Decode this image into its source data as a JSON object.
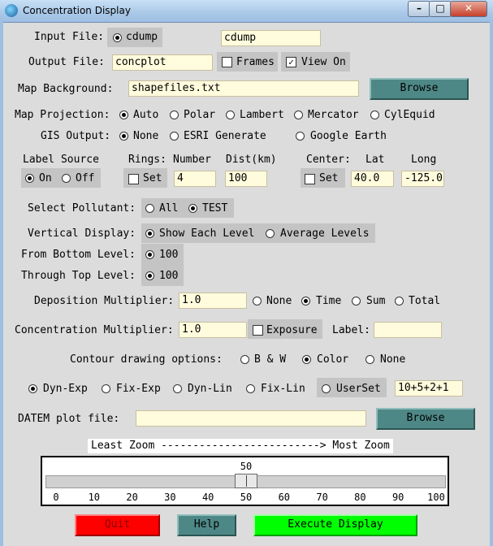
{
  "window": {
    "title": "Concentration Display"
  },
  "input_file": {
    "label": "Input File:",
    "radio": "cdump",
    "value": "cdump"
  },
  "output_file": {
    "label": "Output File:",
    "value": "concplot",
    "frames": "Frames",
    "view_on": "View On"
  },
  "map_background": {
    "label": "Map Background:",
    "value": "shapefiles.txt",
    "browse": "Browse"
  },
  "map_projection": {
    "label": "Map Projection:",
    "options": [
      "Auto",
      "Polar",
      "Lambert",
      "Mercator",
      "CylEquid"
    ],
    "selected": "Auto"
  },
  "gis_output": {
    "label": "GIS Output:",
    "options": [
      "None",
      "ESRI Generate",
      "Google Earth"
    ],
    "selected": "None"
  },
  "label_source": {
    "label": "Label Source",
    "on": "On",
    "off": "Off",
    "selected": "On"
  },
  "rings": {
    "label": "Rings:",
    "number_label": "Number",
    "dist_label": "Dist(km)",
    "set": "Set",
    "number": "4",
    "dist": "100"
  },
  "center": {
    "label": "Center:",
    "lat_label": "Lat",
    "long_label": "Long",
    "set": "Set",
    "lat": "40.0",
    "long": "-125.0"
  },
  "pollutant": {
    "label": "Select Pollutant:",
    "options": [
      "All",
      "TEST"
    ],
    "selected": "TEST"
  },
  "vertical": {
    "label": "Vertical Display:",
    "options": [
      "Show Each Level",
      "Average Levels"
    ],
    "selected": "Show Each Level",
    "bottom_label": "From Bottom Level:",
    "bottom_value": "100",
    "top_label": "Through Top Level:",
    "top_value": "100"
  },
  "deposition": {
    "label": "Deposition Multiplier:",
    "value": "1.0",
    "options": [
      "None",
      "Time",
      "Sum",
      "Total"
    ],
    "selected": "Time"
  },
  "concentration": {
    "label": "Concentration Multiplier:",
    "value": "1.0",
    "exposure": "Exposure",
    "label_label": "Label:",
    "label_value": ""
  },
  "contour": {
    "label": "Contour drawing options:",
    "options": [
      "B & W",
      "Color",
      "None"
    ],
    "selected": "Color"
  },
  "levels": {
    "options": [
      "Dyn-Exp",
      "Fix-Exp",
      "Dyn-Lin",
      "Fix-Lin",
      "UserSet"
    ],
    "selected": "Dyn-Exp",
    "userset_value": "10+5+2+1"
  },
  "datem": {
    "label": "DATEM plot file:",
    "value": "",
    "browse": "Browse"
  },
  "zoom": {
    "label": "Least Zoom -------------------------> Most Zoom",
    "value": 50,
    "ticks": [
      "0",
      "10",
      "20",
      "30",
      "40",
      "50",
      "60",
      "70",
      "80",
      "90",
      "100"
    ]
  },
  "buttons": {
    "quit": "Quit",
    "help": "Help",
    "execute": "Execute Display"
  },
  "colors": {
    "quit_bg": "#ff0000",
    "execute_bg": "#00ff00",
    "teal_bg": "#4e8886",
    "entry_bg": "#fffbdd",
    "group_bg": "#c4c4c4"
  }
}
